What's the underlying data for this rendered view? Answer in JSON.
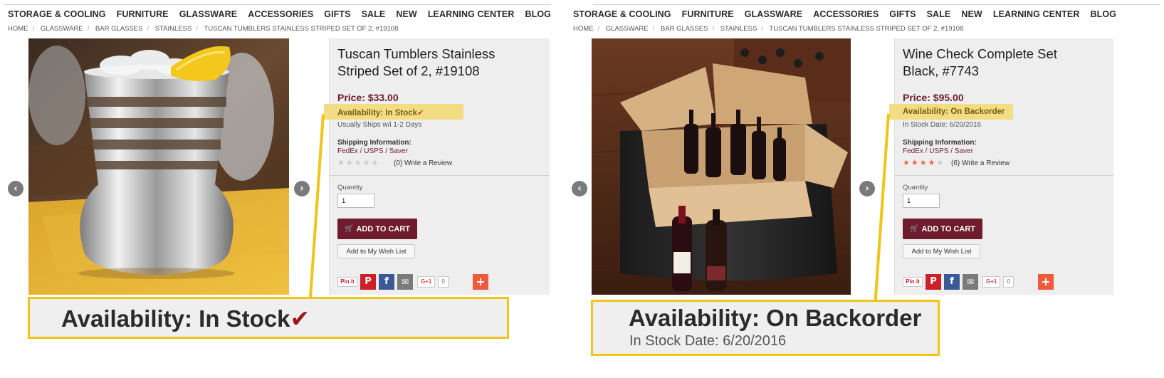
{
  "nav": {
    "items": [
      "STORAGE & COOLING",
      "FURNITURE",
      "GLASSWARE",
      "ACCESSORIES",
      "GIFTS",
      "SALE",
      "NEW",
      "LEARNING CENTER",
      "BLOG"
    ]
  },
  "left": {
    "breadcrumb": [
      "HOME",
      "GLASSWARE",
      "BAR GLASSES",
      "STAINLESS",
      "TUSCAN TUMBLERS STAINLESS STRIPED SET OF 2, #19108"
    ],
    "title": "Tuscan Tumblers Stainless Striped Set of 2, #19108",
    "price": "Price: $33.00",
    "availability": "Availability: In Stock",
    "availability_sub": "Usually Ships w/i 1-2 Days",
    "shipping_label": "Shipping Information:",
    "shipping_value": "FedEx / USPS / Saver",
    "rating": 0,
    "reviews": "(0) Write a Review",
    "quantity_label": "Quantity",
    "quantity_value": "1",
    "add_to_cart": "ADD TO CART",
    "wishlist": "Add to My Wish List",
    "pinit": "Pin it",
    "gplus": "G+1",
    "gplus_count": "0",
    "callout_title": "Availability: In Stock"
  },
  "right": {
    "breadcrumb": [
      "HOME",
      "GLASSWARE",
      "BAR GLASSES",
      "STAINLESS",
      "TUSCAN TUMBLERS STAINLESS STRIPED SET OF 2, #19108"
    ],
    "title": "Wine Check Complete Set Black, #7743",
    "price": "Price: $95.00",
    "availability": "Availability: On Backorder",
    "availability_sub": "In Stock Date: 6/20/2016",
    "shipping_label": "Shipping Information:",
    "shipping_value": "FedEx / USPS / Saver",
    "rating": 4,
    "reviews": "(6) Write a Review",
    "quantity_label": "Quantity",
    "quantity_value": "1",
    "add_to_cart": "ADD TO CART",
    "wishlist": "Add to My Wish List",
    "pinit": "Pin it",
    "gplus": "G+1",
    "gplus_count": "0",
    "callout_title": "Availability: On Backorder",
    "callout_sub": "In Stock Date: 6/20/2016"
  },
  "icons": {
    "check": "✔",
    "cart": "🛒",
    "arrow_left": "‹",
    "arrow_right": "›",
    "plus": "+",
    "pinterest": "P",
    "facebook": "f",
    "mail": "✉",
    "star": "★"
  },
  "colors": {
    "brand": "#6e1c2c",
    "highlight": "#f3dd83",
    "callout": "#f0c419",
    "star_full": "#e8693b",
    "star_empty": "#c9c9c9"
  }
}
